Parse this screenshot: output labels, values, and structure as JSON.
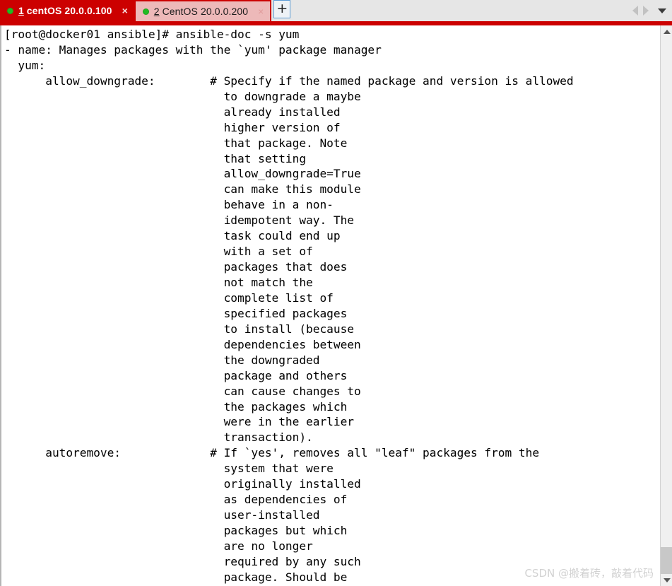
{
  "window": {
    "tabs": [
      {
        "number": "1",
        "title": "centOS 20.0.0.100",
        "status_dot": "connected-dot",
        "close_label": "×",
        "active": true
      },
      {
        "number": "2",
        "title": "CentOS 20.0.0.200",
        "status_dot": "connected-dot",
        "close_label": "×",
        "active": false
      }
    ],
    "new_tab_label": "+",
    "nav": {
      "prev_icon": "chevron-left-icon",
      "next_icon": "chevron-right-icon",
      "menu_icon": "chevron-down-icon"
    },
    "colors": {
      "active_tab_bg": "#cc0000",
      "inactive_tab_bg": "#edb9b9",
      "tabbar_bg": "#e6e6e6",
      "terminal_bg": "#ffffff",
      "terminal_fg": "#000000",
      "status_dot": "#22bb22"
    }
  },
  "scrollbar": {
    "up_icon": "chevron-up-icon",
    "down_icon": "chevron-down-icon"
  },
  "watermark": {
    "text": "CSDN @搬着砖，敲着代码"
  },
  "terminal": {
    "prompt": "[root@docker01 ansible]#",
    "command": "ansible-doc -s yum",
    "lines": [
      "[root@docker01 ansible]# ansible-doc -s yum",
      "- name: Manages packages with the `yum' package manager",
      "  yum:",
      "      allow_downgrade:        # Specify if the named package and version is allowed",
      "                                to downgrade a maybe",
      "                                already installed",
      "                                higher version of",
      "                                that package. Note",
      "                                that setting",
      "                                allow_downgrade=True",
      "                                can make this module",
      "                                behave in a non-",
      "                                idempotent way. The",
      "                                task could end up",
      "                                with a set of",
      "                                packages that does",
      "                                not match the",
      "                                complete list of",
      "                                specified packages",
      "                                to install (because",
      "                                dependencies between",
      "                                the downgraded",
      "                                package and others",
      "                                can cause changes to",
      "                                the packages which",
      "                                were in the earlier",
      "                                transaction).",
      "      autoremove:             # If `yes', removes all \"leaf\" packages from the",
      "                                system that were",
      "                                originally installed",
      "                                as dependencies of",
      "                                user-installed",
      "                                packages but which",
      "                                are no longer",
      "                                required by any such",
      "                                package. Should be"
    ]
  }
}
